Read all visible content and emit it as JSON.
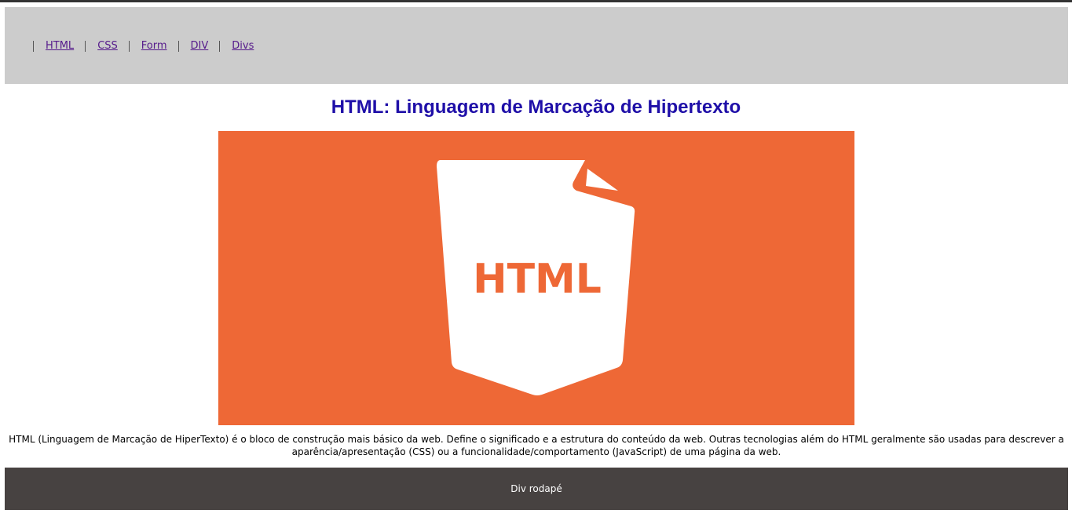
{
  "nav": {
    "items": [
      {
        "label": "HTML"
      },
      {
        "label": "CSS"
      },
      {
        "label": "Form"
      },
      {
        "label": "DIV"
      },
      {
        "label": "Divs"
      }
    ]
  },
  "main": {
    "title": "HTML: Linguagem de Marcação de Hipertexto",
    "hero_logo_text": "HTML",
    "description": "HTML (Linguagem de Marcação de HiperTexto) é o bloco de construção mais básico da web. Define o significado e a estrutura do conteúdo da web. Outras tecnologias além do HTML geralmente são usadas para descrever a aparência/apresentação (CSS) ou a funcionalidade/comportamento (JavaScript) de uma página da web."
  },
  "footer": {
    "text": "Div rodapé"
  },
  "colors": {
    "header_bg": "#cccccc",
    "title": "#1f0fa8",
    "hero_bg": "#ee6836",
    "footer_bg": "#474241",
    "link": "#551a8b"
  }
}
